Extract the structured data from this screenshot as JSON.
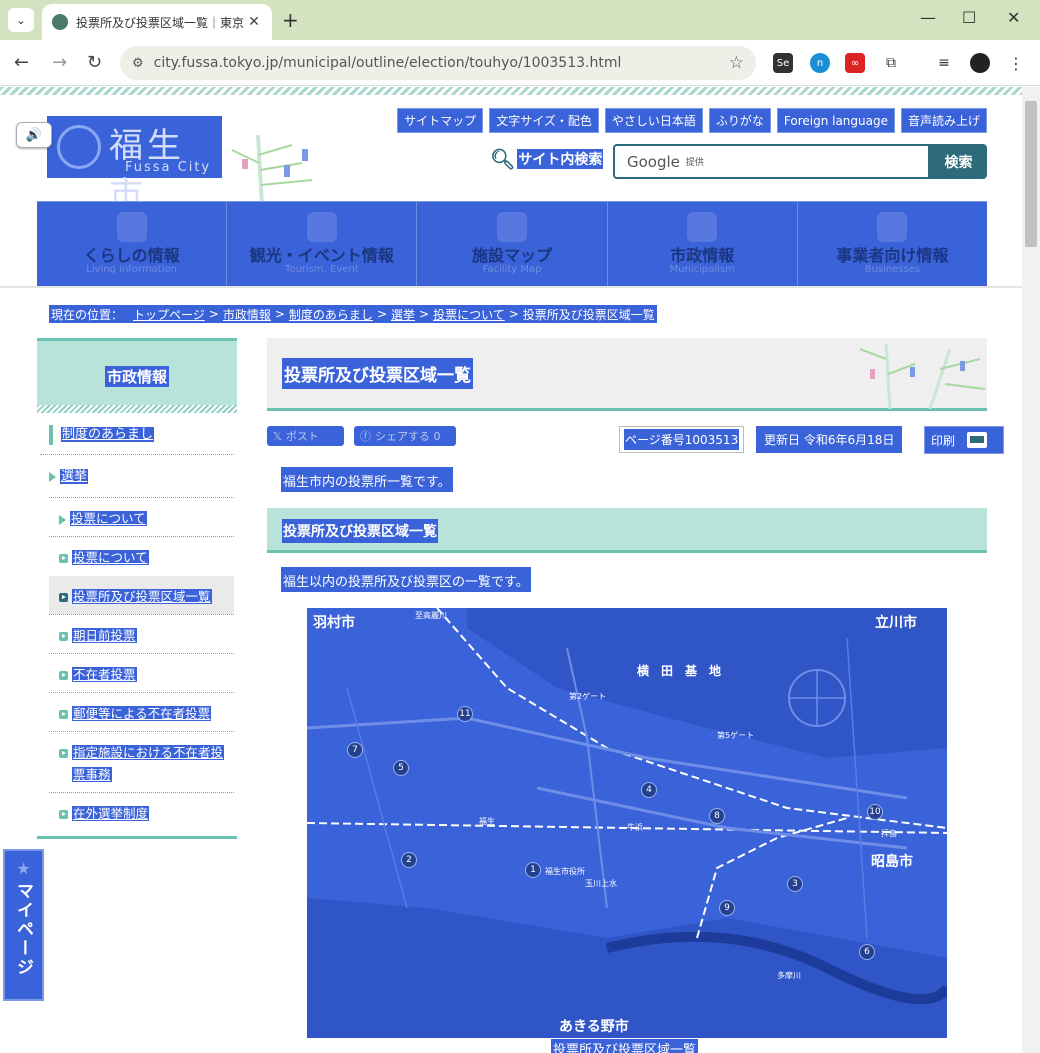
{
  "browser": {
    "tab_title": "投票所及び投票区域一覧｜東京",
    "url": "city.fussa.tokyo.jp/municipal/outline/election/touhyo/1003513.html"
  },
  "header": {
    "logo_jp": "福生市",
    "logo_en": "Fussa City",
    "util_links": [
      "サイトマップ",
      "文字サイズ・配色",
      "やさしい日本語",
      "ふりがな",
      "Foreign language",
      "音声読み上げ"
    ],
    "search_label": "サイト内検索",
    "search_google": "Google",
    "search_provided": "提供",
    "search_button": "検索"
  },
  "gnav": [
    {
      "jp": "くらしの情報",
      "en": "Living information"
    },
    {
      "jp": "観光・イベント情報",
      "en": "Tourism, Event"
    },
    {
      "jp": "施設マップ",
      "en": "Facility Map"
    },
    {
      "jp": "市政情報",
      "en": "Municipalism"
    },
    {
      "jp": "事業者向け情報",
      "en": "Businesses"
    }
  ],
  "breadcrumb": {
    "prefix": "現在の位置：",
    "items": [
      "トップページ",
      "市政情報",
      "制度のあらまし",
      "選挙",
      "投票について"
    ],
    "current": "投票所及び投票区域一覧",
    "sep": ">"
  },
  "sidebar": {
    "heading": "市政情報",
    "items": [
      "制度のあらまし",
      "選挙",
      "投票について",
      "投票について",
      "投票所及び投票区域一覧",
      "期日前投票",
      "不在者投票",
      "郵便等による不在者投票",
      "指定施設における不在者投",
      "票事務",
      "在外選挙制度"
    ]
  },
  "mypage": "マイページ",
  "main": {
    "title": "投票所及び投票区域一覧",
    "social_post": "ポスト",
    "social_share": "シェアする 0",
    "page_number": "ページ番号1003513",
    "updated": "更新日 令和6年6月18日",
    "print": "印刷",
    "intro": "福生市内の投票所一覧です。",
    "section_title": "投票所及び投票区域一覧",
    "section_intro": "福生以内の投票所及び投票区の一覧です。",
    "map_caption": "投票所及び投票区域一覧"
  },
  "map_labels": {
    "hamura": "羽村市",
    "tachikawa": "立川市",
    "akishima": "昭島市",
    "akiruno": "あきる野市",
    "yokota": "横　田　基　地",
    "fussa_office": "福生市役所",
    "daini_gate": "第2ゲート",
    "daigo_gate": "第5ゲート",
    "ichi_gate": "至高麗川",
    "ushihama": "牛浜",
    "fussa_st": "福生",
    "haijima": "拝島",
    "tamagawa": "多摩川",
    "tamagawa_jo": "玉川上水"
  },
  "colors": {
    "selection": "#3a62d9",
    "accent_teal": "#6bc0b0",
    "accent_dark": "#2d6a7a"
  }
}
